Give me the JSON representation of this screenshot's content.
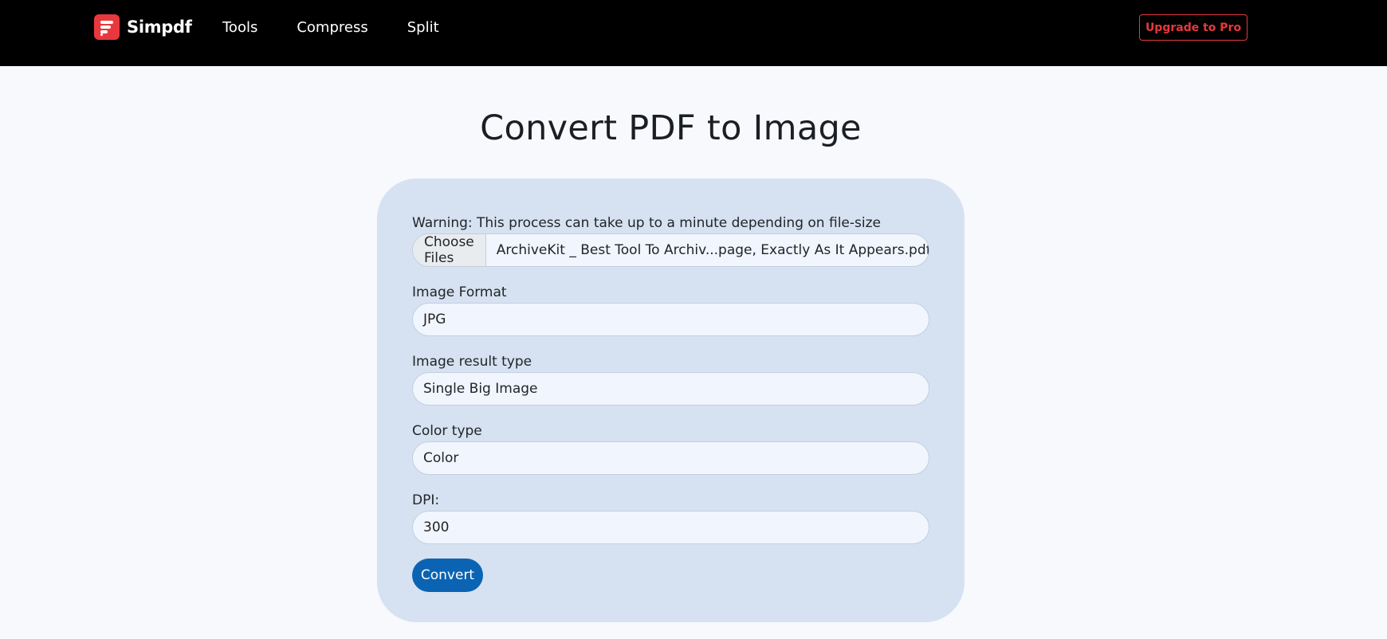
{
  "navbar": {
    "brand": "Simpdf",
    "links": [
      "Tools",
      "Compress",
      "Split"
    ],
    "upgrade_label": "Upgrade to Pro",
    "accent_color": "#e8383d"
  },
  "main": {
    "title": "Convert PDF to Image",
    "warning": "Warning: This process can take up to a minute depending on file-size",
    "file": {
      "button_label": "Choose Files",
      "file_name": "ArchiveKit _ Best Tool To Archiv...page, Exactly As It Appears.pdf"
    },
    "fields": [
      {
        "label": "Image Format",
        "value": "JPG"
      },
      {
        "label": "Image result type",
        "value": "Single Big Image"
      },
      {
        "label": "Color type",
        "value": "Color"
      },
      {
        "label": "DPI:",
        "value": "300"
      }
    ],
    "convert_label": "Convert",
    "button_color": "#0b63b3"
  }
}
